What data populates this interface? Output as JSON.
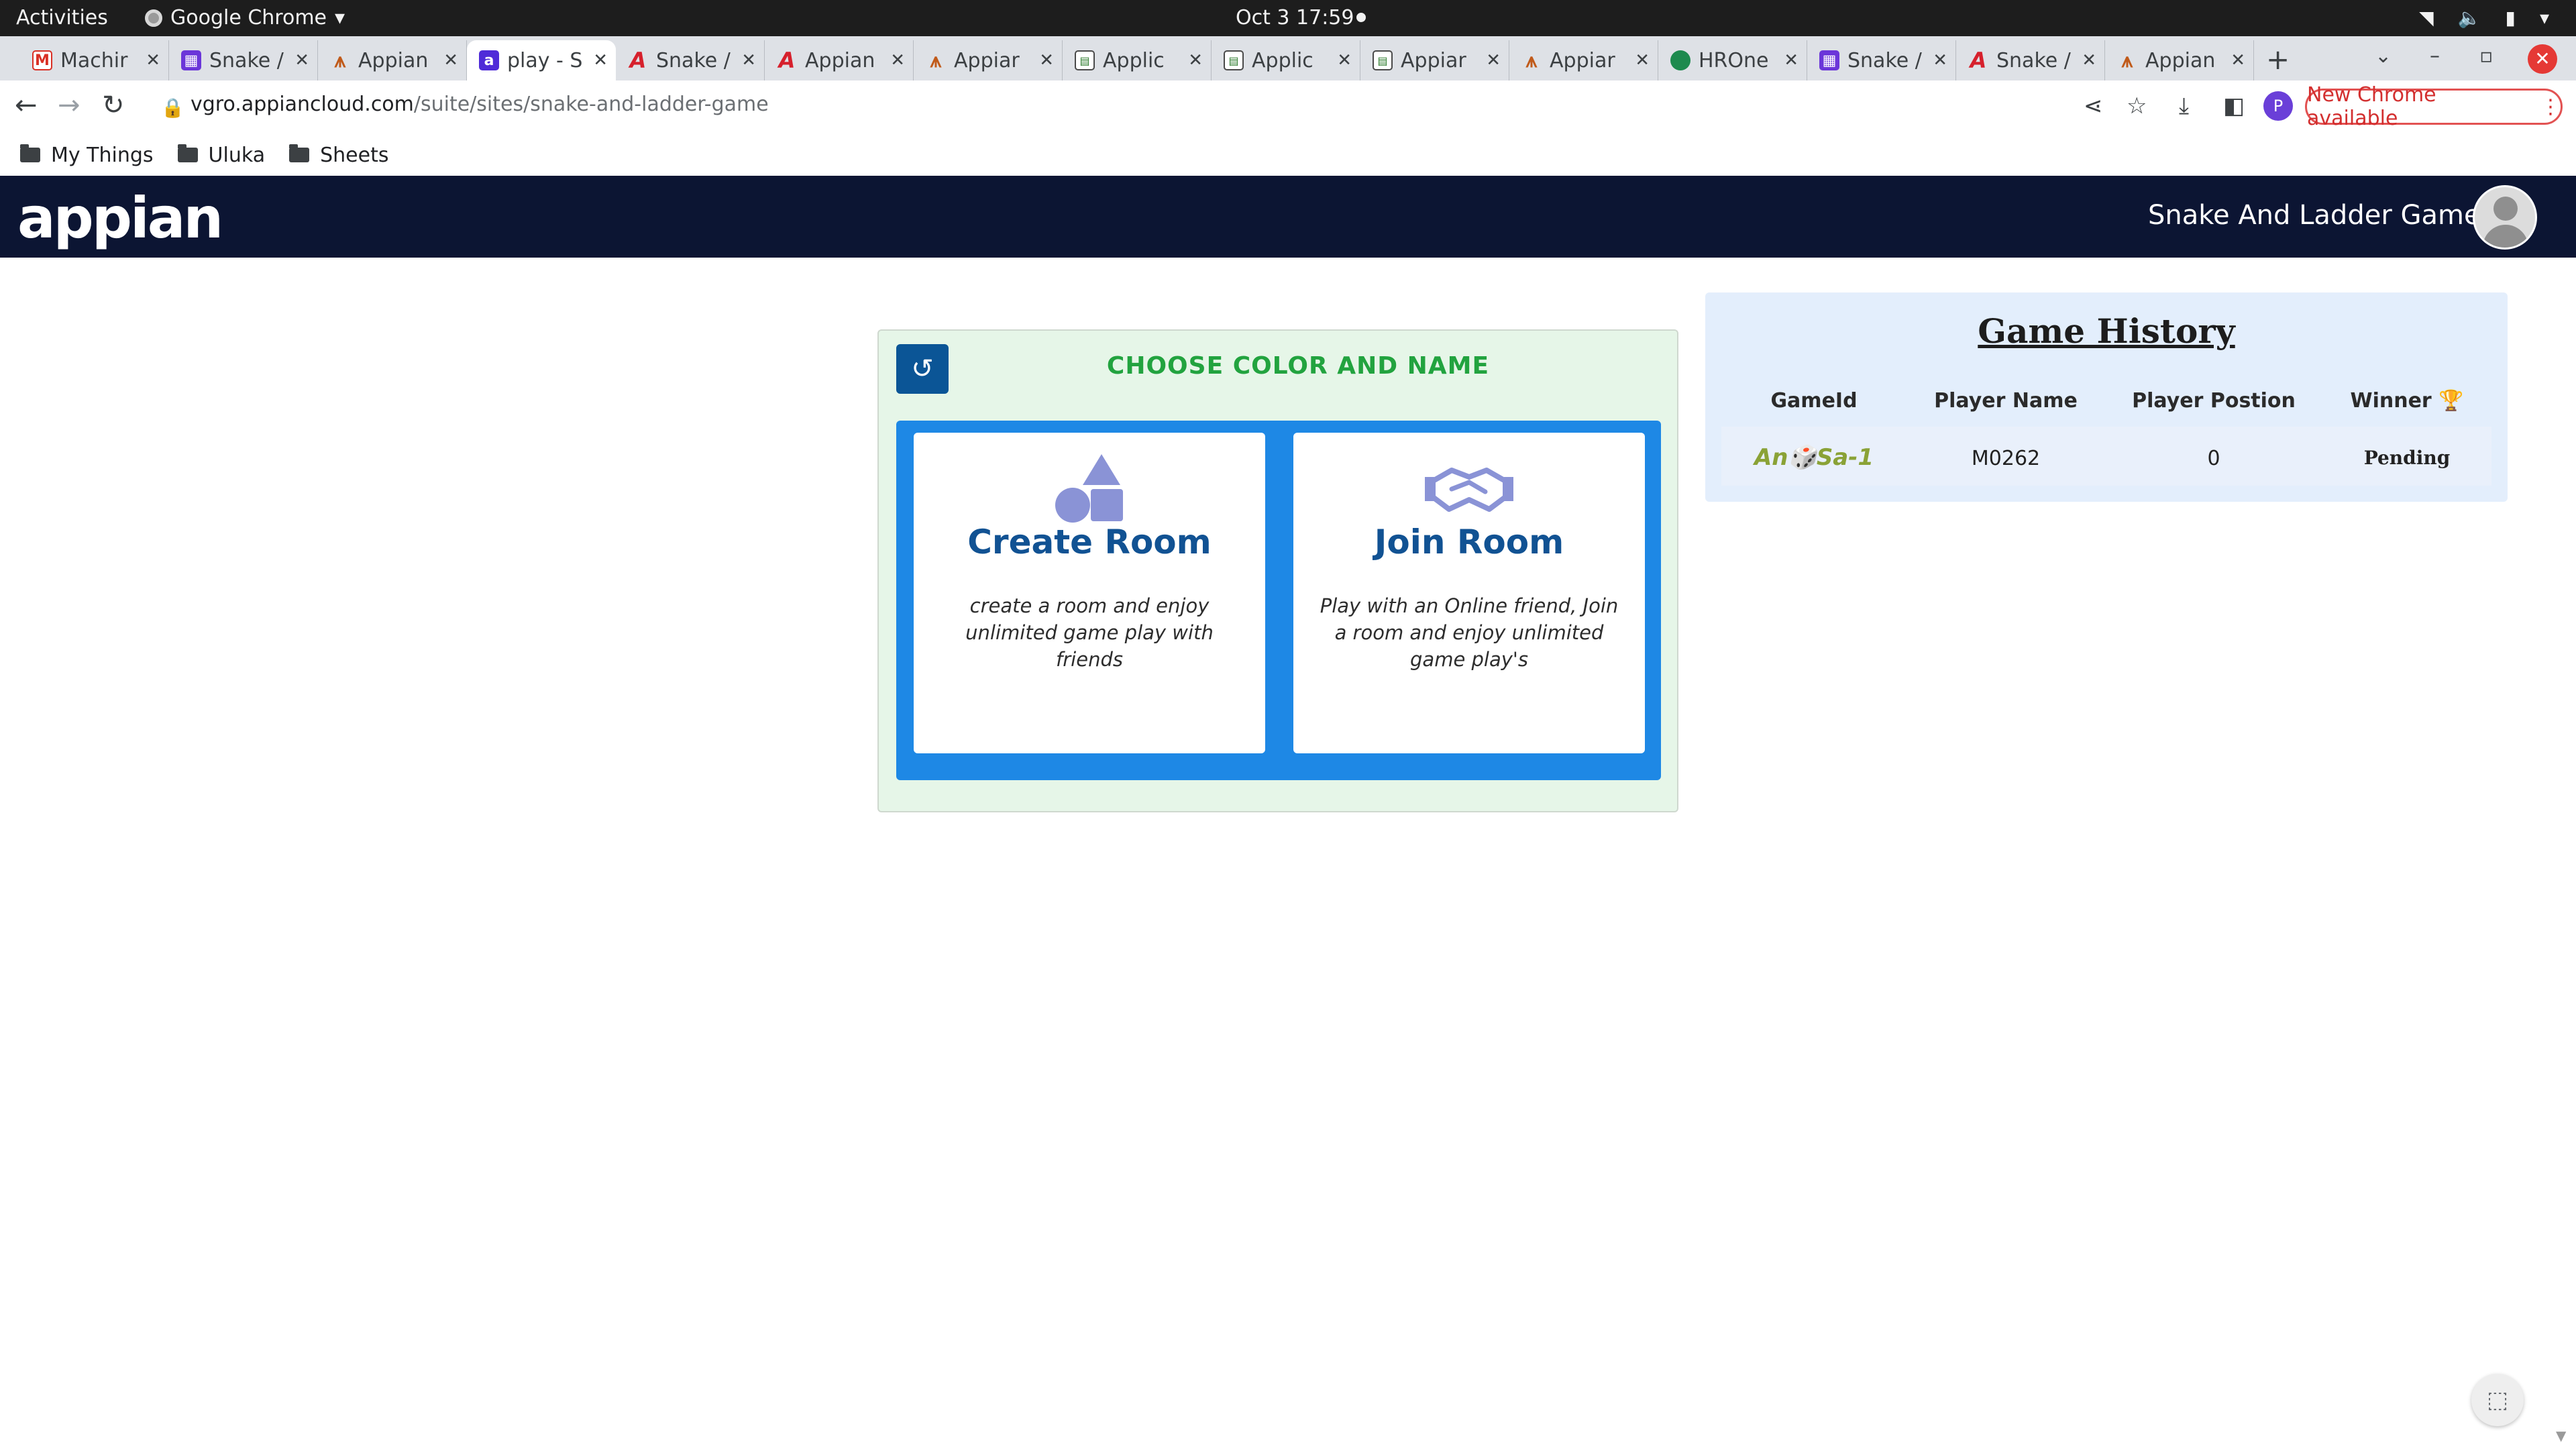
{
  "os_bar": {
    "activities": "Activities",
    "app_name": "Google Chrome",
    "clock": "Oct 3  17:59"
  },
  "tabs": [
    {
      "label": "Machir",
      "favicon": "gmail-icon"
    },
    {
      "label": "Snake /",
      "favicon": "grid-icon"
    },
    {
      "label": "Appian",
      "favicon": "appian-icon"
    },
    {
      "label": "play - S",
      "favicon": "appian-a-icon",
      "active": true
    },
    {
      "label": "Snake /",
      "favicon": "appian-a-red-icon"
    },
    {
      "label": "Appian",
      "favicon": "appian-a-red-icon"
    },
    {
      "label": "Appiar",
      "favicon": "appian-icon"
    },
    {
      "label": "Applic",
      "favicon": "sheet-icon"
    },
    {
      "label": "Applic",
      "favicon": "sheet-icon"
    },
    {
      "label": "Appiar",
      "favicon": "sheet-icon"
    },
    {
      "label": "Appiar",
      "favicon": "appian-icon"
    },
    {
      "label": "HROne",
      "favicon": "hrone-icon"
    },
    {
      "label": "Snake /",
      "favicon": "grid-icon"
    },
    {
      "label": "Snake /",
      "favicon": "appian-a-red-icon"
    },
    {
      "label": "Appian",
      "favicon": "appian-icon"
    }
  ],
  "address_bar": {
    "url_host": "vgro.appiancloud.com",
    "url_path": "/suite/sites/snake-and-ladder-game",
    "profile_initial": "P",
    "update_label": "New Chrome available"
  },
  "bookmarks": [
    {
      "label": "My Things"
    },
    {
      "label": "Uluka"
    },
    {
      "label": "Sheets"
    }
  ],
  "app_header": {
    "logo": "appian",
    "site_name": "Snake And Ladder Game"
  },
  "choose_panel": {
    "title": "CHOOSE COLOR AND NAME",
    "create": {
      "title": "Create Room",
      "description": "create a room and enjoy unlimited game play with friends"
    },
    "join": {
      "title": "Join Room",
      "description": "Play with an Online friend, Join a room and enjoy unlimited game play's"
    }
  },
  "history": {
    "title": "Game History",
    "columns": [
      "GameId",
      "Player Name",
      "Player Postion",
      "Winner 🏆"
    ],
    "rows": [
      {
        "game_id": "An🎲Sa-1",
        "player_name": "M0262",
        "player_position": "0",
        "winner": "Pending"
      }
    ]
  },
  "colors": {
    "header_bg": "#0c1533",
    "panel_title": "#22a33f",
    "options_bg": "#1e88e5",
    "card_title": "#115293",
    "history_bg": "#e3eefc",
    "update_pill": "#d32f2f"
  }
}
